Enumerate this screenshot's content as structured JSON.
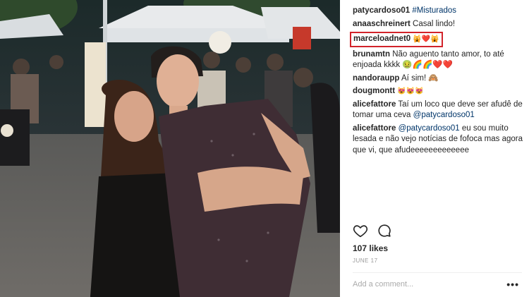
{
  "post": {
    "caption": {
      "user": "patycardoso01",
      "text": "#Misturados"
    },
    "comments": [
      {
        "user": "anaaschreinert",
        "text": "Casal lindo!"
      },
      {
        "user": "marceloadnet0",
        "text": "🙀❤️🙀"
      },
      {
        "user": "brunamtn",
        "text": "Não aguento tanto amor, to até enjoada kkkk 🤢🌈🌈❤️❤️"
      },
      {
        "user": "nandoraupp",
        "text": "Aí sim! 🙈"
      },
      {
        "user": "dougmontt",
        "text": "😻😻😻"
      },
      {
        "user": "alicefattore",
        "text": "Taí um loco que deve ser afudê de tomar uma ceva",
        "mention": "@patycardoso01"
      },
      {
        "user": "alicefattore",
        "mention": "@patycardoso01",
        "text": "eu sou muito lesada e não vejo notícias de fofoca mas agora que vi, que afudeeeeeeeeeeeee"
      }
    ],
    "likes": "107 likes",
    "date": "JUNE 17",
    "add_comment_placeholder": "Add a comment...",
    "more_label": "•••",
    "highlight_color": "#d2232a"
  },
  "icons": {
    "like": "heart-outline-icon",
    "comment": "speech-bubble-icon"
  }
}
